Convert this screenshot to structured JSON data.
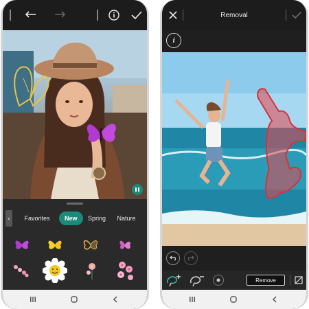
{
  "left_screen": {
    "sticker_tabs": [
      "Favorites",
      "New",
      "Spring",
      "Nature"
    ],
    "active_tab": "New",
    "icons": {
      "toolbar": [
        "divider-icon",
        "undo-icon",
        "redo-icon",
        "info-icon",
        "check-icon"
      ],
      "stickers": [
        "purple-butterfly-icon",
        "yellow-butterfly-icon",
        "gold-butterfly-icon",
        "pink-butterfly-icon",
        "pink-blossom-branch-icon",
        "smiling-daisy-icon",
        "pink-flowers-icon",
        "cherry-blossom-icon"
      ],
      "photo_overlay": [
        "gold-butterfly-sticker",
        "purple-butterfly-sticker",
        "pause-icon"
      ]
    }
  },
  "right_screen": {
    "title": "Removal",
    "remove_button": "Remove",
    "icons": {
      "toolbar": [
        "close-icon",
        "check-icon"
      ],
      "info": "info-icon",
      "history": [
        "undo-icon",
        "redo-icon"
      ],
      "tools": [
        "lasso-add-icon",
        "lasso-subtract-icon",
        "brush-size-icon",
        "eraser-icon"
      ]
    }
  },
  "system_nav": [
    "recents-icon",
    "home-icon",
    "back-icon"
  ],
  "colors": {
    "accent_teal": "#1c8a7b",
    "selection_red": "#e8454a",
    "toolbar_dark": "#1c1c1c",
    "sheet_dark": "#2a2a2a"
  }
}
